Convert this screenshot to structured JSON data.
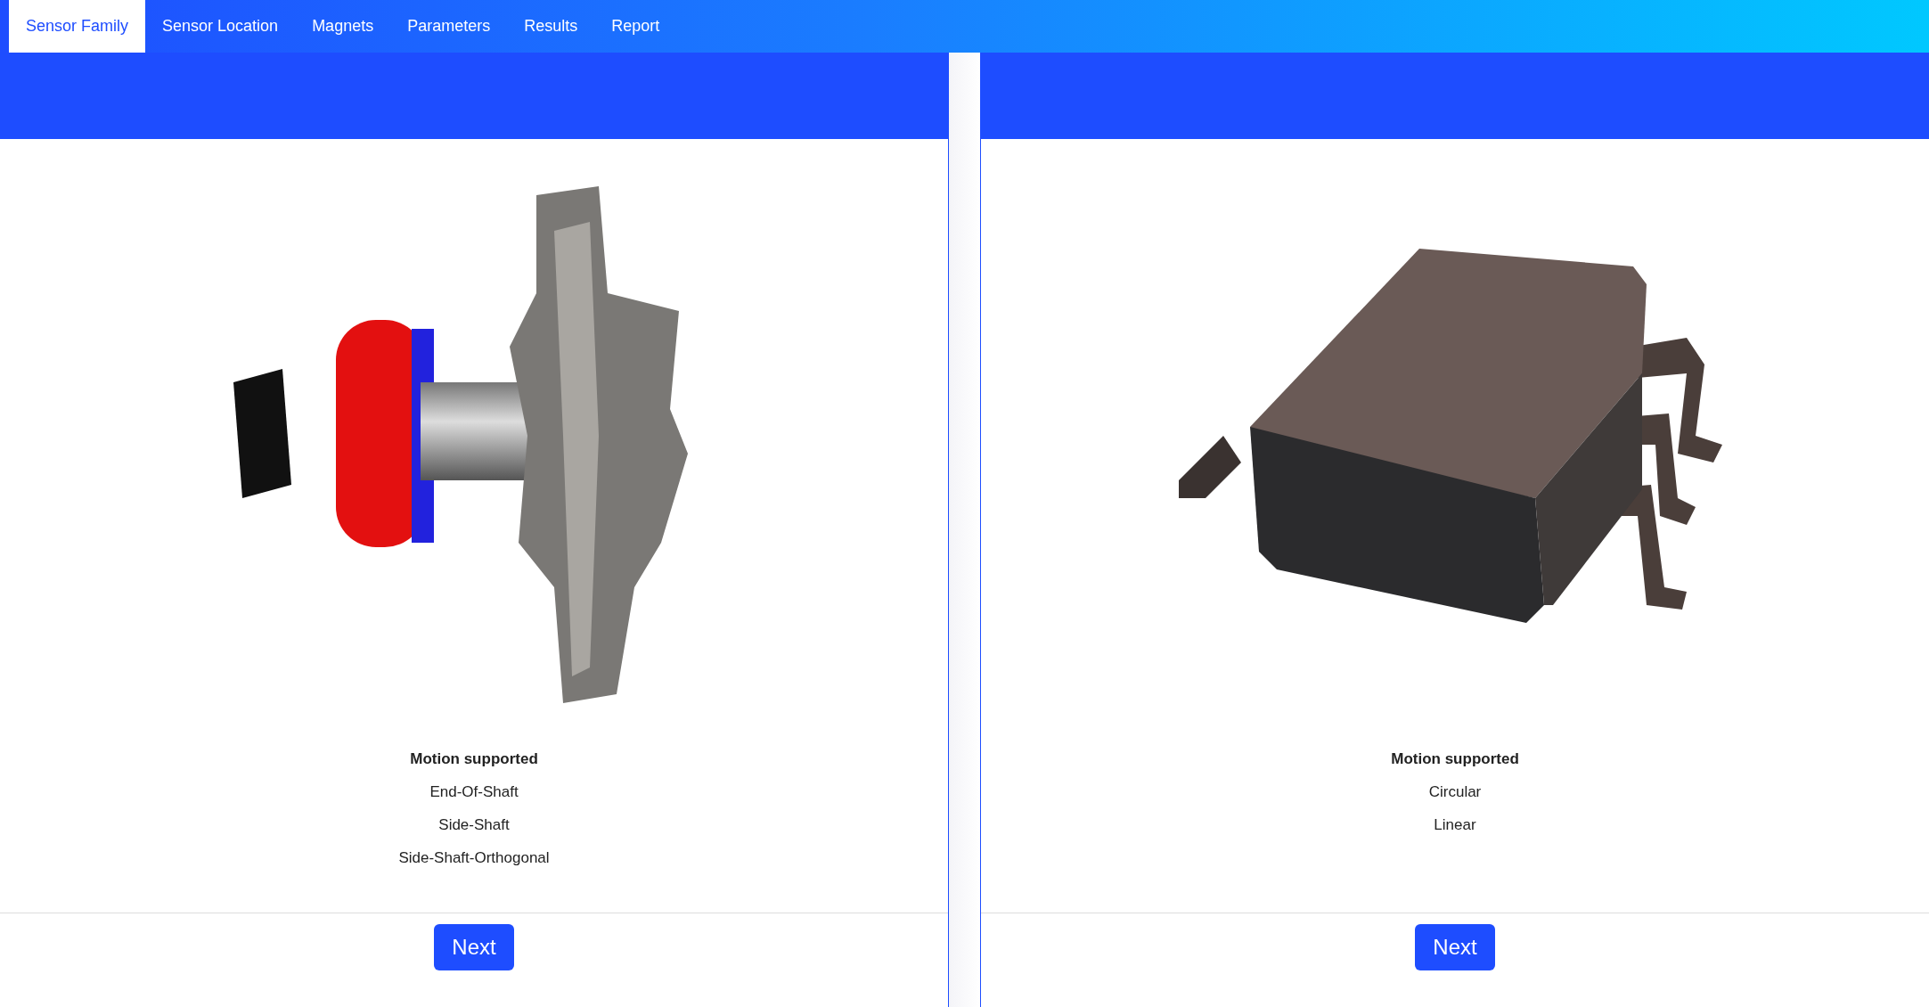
{
  "tabs": [
    {
      "label": "Sensor Family",
      "selected": true
    },
    {
      "label": "Sensor Location",
      "selected": false
    },
    {
      "label": "Magnets",
      "selected": false
    },
    {
      "label": "Parameters",
      "selected": false
    },
    {
      "label": "Results",
      "selected": false
    },
    {
      "label": "Report",
      "selected": false
    }
  ],
  "cards": [
    {
      "kind": "shaft",
      "heading": "Motion supported",
      "motions": [
        "End-Of-Shaft",
        "Side-Shaft",
        "Side-Shaft-Orthogonal"
      ],
      "button": "Next"
    },
    {
      "kind": "chip",
      "heading": "Motion supported",
      "motions": [
        "Circular",
        "Linear"
      ],
      "button": "Next"
    }
  ]
}
